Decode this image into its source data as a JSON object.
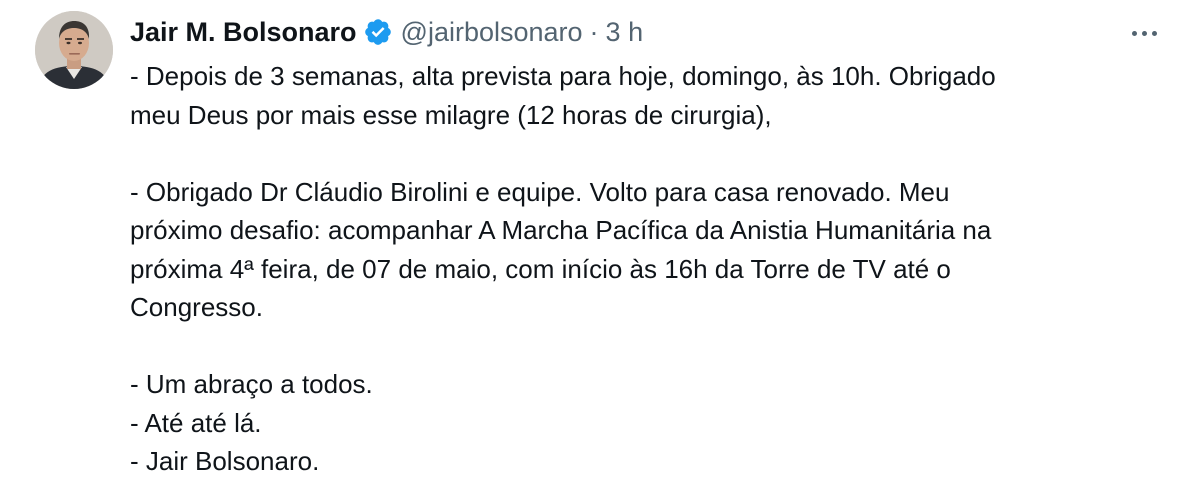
{
  "author": {
    "display_name": "Jair M. Bolsonaro",
    "handle": "@jairbolsonaro",
    "separator": "·",
    "timestamp": "3 h",
    "verified": true,
    "verified_color": "#1d9bf0",
    "avatar_icon": "profile-photo"
  },
  "menu": {
    "more_icon": "more-horizontal-icon"
  },
  "tweet": {
    "paragraph_1": [
      "- Depois de 3 semanas, alta prevista para hoje, domingo, às 10h. Obrigado",
      "meu Deus por mais esse milagre (12 horas de cirurgia),"
    ],
    "paragraph_2": [
      "- Obrigado Dr Cláudio Birolini e equipe. Volto para casa renovado. Meu",
      "próximo desafio: acompanhar A Marcha Pacífica da Anistia Humanitária na",
      "próxima 4ª feira, de 07 de maio, com início às 16h da Torre de TV até o",
      "Congresso."
    ],
    "paragraph_3": [
      "- Um abraço a todos.",
      "- Até até lá.",
      "- Jair Bolsonaro."
    ]
  },
  "colors": {
    "text": "#0f1419",
    "secondary": "#536471",
    "background": "#ffffff"
  }
}
